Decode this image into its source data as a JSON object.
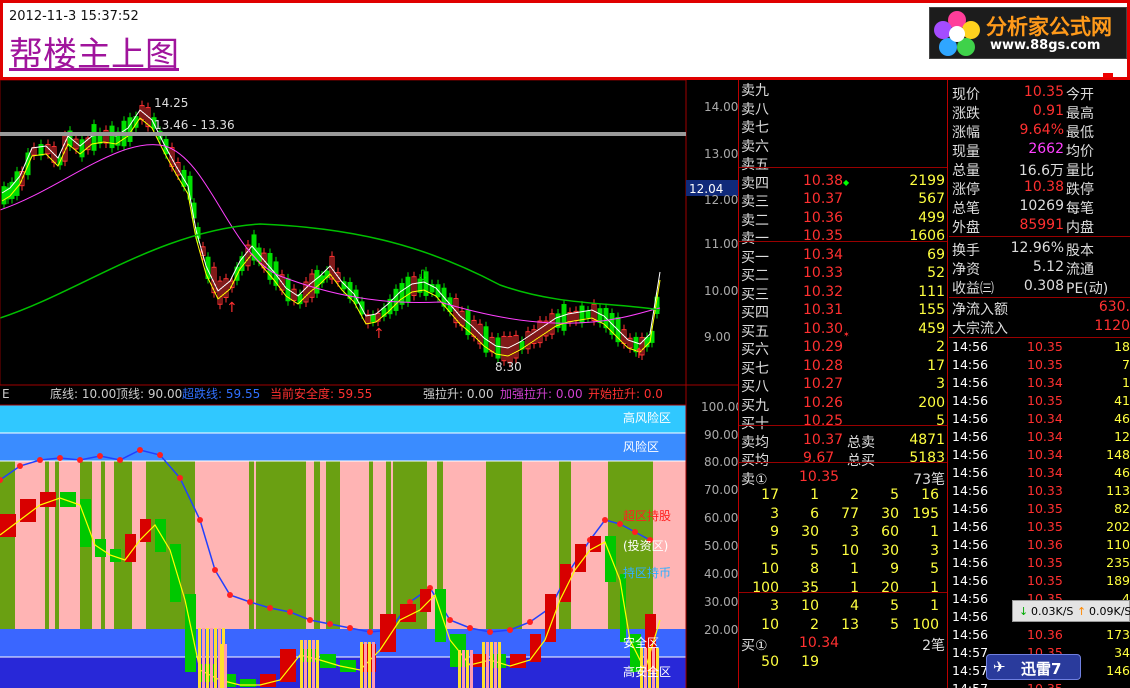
{
  "header": {
    "timestamp": "2012-11-3 15:37:52",
    "title": "帮楼主上图"
  },
  "logo": {
    "name": "分析家公式网",
    "url": "www.88gs.com"
  },
  "price_chart": {
    "y_ticks": [
      "14.00",
      "13.00",
      "12.00",
      "11.00",
      "10.00",
      "9.00"
    ],
    "current_price_tag": "12.04",
    "high_label": "14.25",
    "range_label": "13.46 - 13.36",
    "low_label": "8.30",
    "colors": {
      "up": "#ff3232",
      "down": "#00e000",
      "ma5": "#ffffff",
      "ma10": "#ffff00",
      "ma20": "#ff40ff",
      "ma60": "#00c000"
    }
  },
  "indicator": {
    "legend": [
      {
        "text": "E",
        "color": "#cccccc"
      },
      {
        "text": "底线: 10.00",
        "color": "#cccccc"
      },
      {
        "text": "顶线: 90.00",
        "color": "#cccccc"
      },
      {
        "text": "超跌线: 59.55",
        "color": "#3070ff"
      },
      {
        "text": "当前安全度: 59.55",
        "color": "#ff3030"
      },
      {
        "text": "强拉升: 0.00",
        "color": "#cccccc"
      },
      {
        "text": "加强拉升: 0.00",
        "color": "#d040d0"
      },
      {
        "text": "开始拉升: 0.0",
        "color": "#ff3030"
      }
    ],
    "y_ticks": [
      "100.00",
      "90.00",
      "80.00",
      "70.00",
      "60.00",
      "50.00",
      "40.00",
      "30.00",
      "20.00"
    ],
    "zone_labels": [
      {
        "text": "高风险区",
        "color": "#ffffff"
      },
      {
        "text": "风险区",
        "color": "#ffffff"
      },
      {
        "text": "超区持股",
        "color": "#ff2020"
      },
      {
        "text": "(投资区)",
        "color": "#ffffff"
      },
      {
        "text": "持区持币",
        "color": "#30b0ff"
      },
      {
        "text": "安全区",
        "color": "#ffffff"
      },
      {
        "text": "高安全区",
        "color": "#ffffff"
      }
    ]
  },
  "orderbook": {
    "asks": [
      {
        "label": "卖九",
        "price": "",
        "vol": ""
      },
      {
        "label": "卖八",
        "price": "",
        "vol": ""
      },
      {
        "label": "卖七",
        "price": "",
        "vol": ""
      },
      {
        "label": "卖六",
        "price": "",
        "vol": ""
      },
      {
        "label": "卖五",
        "price": "",
        "vol": ""
      },
      {
        "label": "卖四",
        "price": "10.38",
        "vol": "2199"
      },
      {
        "label": "卖三",
        "price": "10.37",
        "vol": "567"
      },
      {
        "label": "卖二",
        "price": "10.36",
        "vol": "499"
      },
      {
        "label": "卖一",
        "price": "10.35",
        "vol": "1606"
      }
    ],
    "bids": [
      {
        "label": "买一",
        "price": "10.34",
        "vol": "69"
      },
      {
        "label": "买二",
        "price": "10.33",
        "vol": "52"
      },
      {
        "label": "买三",
        "price": "10.32",
        "vol": "111"
      },
      {
        "label": "买四",
        "price": "10.31",
        "vol": "155"
      },
      {
        "label": "买五",
        "price": "10.30",
        "vol": "459"
      },
      {
        "label": "买六",
        "price": "10.29",
        "vol": "2"
      },
      {
        "label": "买七",
        "price": "10.28",
        "vol": "17"
      },
      {
        "label": "买八",
        "price": "10.27",
        "vol": "3"
      },
      {
        "label": "买九",
        "price": "10.26",
        "vol": "200"
      },
      {
        "label": "买十",
        "price": "10.25",
        "vol": "5"
      }
    ],
    "avg_sell": {
      "label": "卖均",
      "price": "10.37",
      "tlabel": "总卖",
      "total": "4871"
    },
    "avg_buy": {
      "label": "买均",
      "price": "9.67",
      "tlabel": "总买",
      "total": "5183"
    },
    "sell1_queue": {
      "label": "卖①",
      "price": "10.35",
      "count": "73笔"
    },
    "sell_grid": [
      [
        "17",
        "1",
        "2",
        "5",
        "16"
      ],
      [
        "3",
        "6",
        "77",
        "30",
        "195"
      ],
      [
        "9",
        "30",
        "3",
        "60",
        "1"
      ],
      [
        "5",
        "5",
        "10",
        "30",
        "3"
      ],
      [
        "10",
        "8",
        "1",
        "9",
        "5"
      ],
      [
        "100",
        "35",
        "1",
        "20",
        "1"
      ],
      [
        "3",
        "10",
        "4",
        "5",
        "1"
      ],
      [
        "10",
        "2",
        "13",
        "5",
        "100"
      ]
    ],
    "buy1_queue": {
      "label": "买①",
      "price": "10.34",
      "count": "2笔"
    },
    "buy_grid": [
      [
        "50",
        "19"
      ]
    ]
  },
  "quote_info": {
    "rows": [
      {
        "l1": "现价",
        "v1": "10.35",
        "c1": "#ff3030",
        "l2": "今开"
      },
      {
        "l1": "涨跌",
        "v1": "0.91",
        "c1": "#ff3030",
        "l2": "最高"
      },
      {
        "l1": "涨幅",
        "v1": "9.64%",
        "c1": "#ff3030",
        "l2": "最低"
      },
      {
        "l1": "现量",
        "v1": "2662",
        "c1": "#ff40ff",
        "l2": "均价"
      },
      {
        "l1": "总量",
        "v1": "16.6万",
        "c1": "#dddddd",
        "l2": "量比"
      },
      {
        "l1": "涨停",
        "v1": "10.38",
        "c1": "#ff3030",
        "l2": "跌停"
      },
      {
        "l1": "总笔",
        "v1": "10269",
        "c1": "#dddddd",
        "l2": "每笔"
      },
      {
        "l1": "外盘",
        "v1": "85991",
        "c1": "#ff3030",
        "l2": "内盘"
      }
    ],
    "rows2": [
      {
        "l1": "换手",
        "v1": "12.96%",
        "c1": "#dddddd",
        "l2": "股本"
      },
      {
        "l1": "净资",
        "v1": "5.12",
        "c1": "#dddddd",
        "l2": "流通"
      },
      {
        "l1": "收益㈢",
        "v1": "0.308",
        "c1": "#dddddd",
        "l2": "PE(动)"
      }
    ],
    "flows": [
      {
        "label": "净流入额",
        "value": "630."
      },
      {
        "label": "大宗流入",
        "value": "1120"
      }
    ]
  },
  "ticks": [
    {
      "time": "14:56",
      "price": "10.35",
      "vol": "18"
    },
    {
      "time": "14:56",
      "price": "10.35",
      "vol": "7"
    },
    {
      "time": "14:56",
      "price": "10.34",
      "vol": "1"
    },
    {
      "time": "14:56",
      "price": "10.35",
      "vol": "41"
    },
    {
      "time": "14:56",
      "price": "10.34",
      "vol": "46"
    },
    {
      "time": "14:56",
      "price": "10.34",
      "vol": "12"
    },
    {
      "time": "14:56",
      "price": "10.34",
      "vol": "148"
    },
    {
      "time": "14:56",
      "price": "10.34",
      "vol": "46"
    },
    {
      "time": "14:56",
      "price": "10.33",
      "vol": "113"
    },
    {
      "time": "14:56",
      "price": "10.35",
      "vol": "82"
    },
    {
      "time": "14:56",
      "price": "10.35",
      "vol": "202"
    },
    {
      "time": "14:56",
      "price": "10.36",
      "vol": "110"
    },
    {
      "time": "14:56",
      "price": "10.35",
      "vol": "235"
    },
    {
      "time": "14:56",
      "price": "10.35",
      "vol": "189"
    },
    {
      "time": "14:56",
      "price": "10.35",
      "vol": "4"
    },
    {
      "time": "14:56",
      "price": "",
      "vol": ""
    },
    {
      "time": "14:56",
      "price": "10.36",
      "vol": "173"
    },
    {
      "time": "14:57",
      "price": "10.35",
      "vol": "34"
    },
    {
      "time": "14:57",
      "price": "10.35",
      "vol": "146"
    },
    {
      "time": "14:57",
      "price": "10.35",
      "vol": ""
    }
  ],
  "speed": {
    "down": "0.03K/S",
    "up": "0.09K/S"
  },
  "xunlei": {
    "label": "迅雷7"
  }
}
